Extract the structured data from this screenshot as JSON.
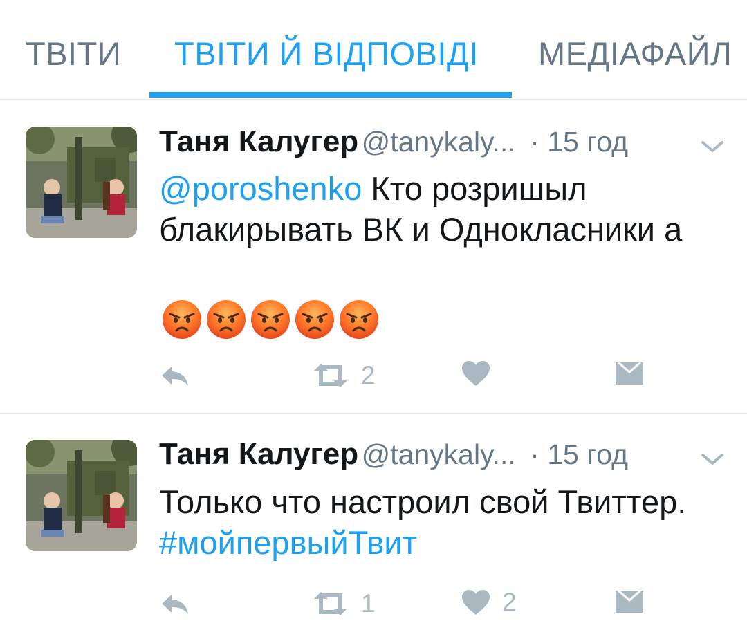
{
  "tabs": [
    {
      "label": "ТВІТИ",
      "active": false
    },
    {
      "label": "ТВІТИ Й ВІДПОВІДІ",
      "active": true
    },
    {
      "label": "МЕДІАФАЙЛ",
      "active": false
    }
  ],
  "tweets": [
    {
      "name": "Таня Калугер",
      "handle": "@tanykaly...",
      "time": "· 15 год",
      "mention": "@poroshenko",
      "text": " Кто розришыл блакирывать ВК и Однокласники а",
      "emoji": [
        "angry-face",
        "angry-face",
        "angry-face",
        "angry-face",
        "angry-face"
      ],
      "retweets": "2",
      "likes": ""
    },
    {
      "name": "Таня Калугер",
      "handle": "@tanykaly...",
      "time": "· 15 год",
      "text": "Только что настроил свой Твиттер. ",
      "hashtag": "#мойпервыйТвит",
      "retweets": "1",
      "likes": "2"
    }
  ],
  "colors": {
    "accent": "#1da1f2",
    "muted": "#657786",
    "icon": "#aab8c2",
    "divider": "#e1e8ed"
  },
  "icons": [
    "reply-icon",
    "retweet-icon",
    "like-icon",
    "direct-message-icon",
    "chevron-down-icon"
  ]
}
